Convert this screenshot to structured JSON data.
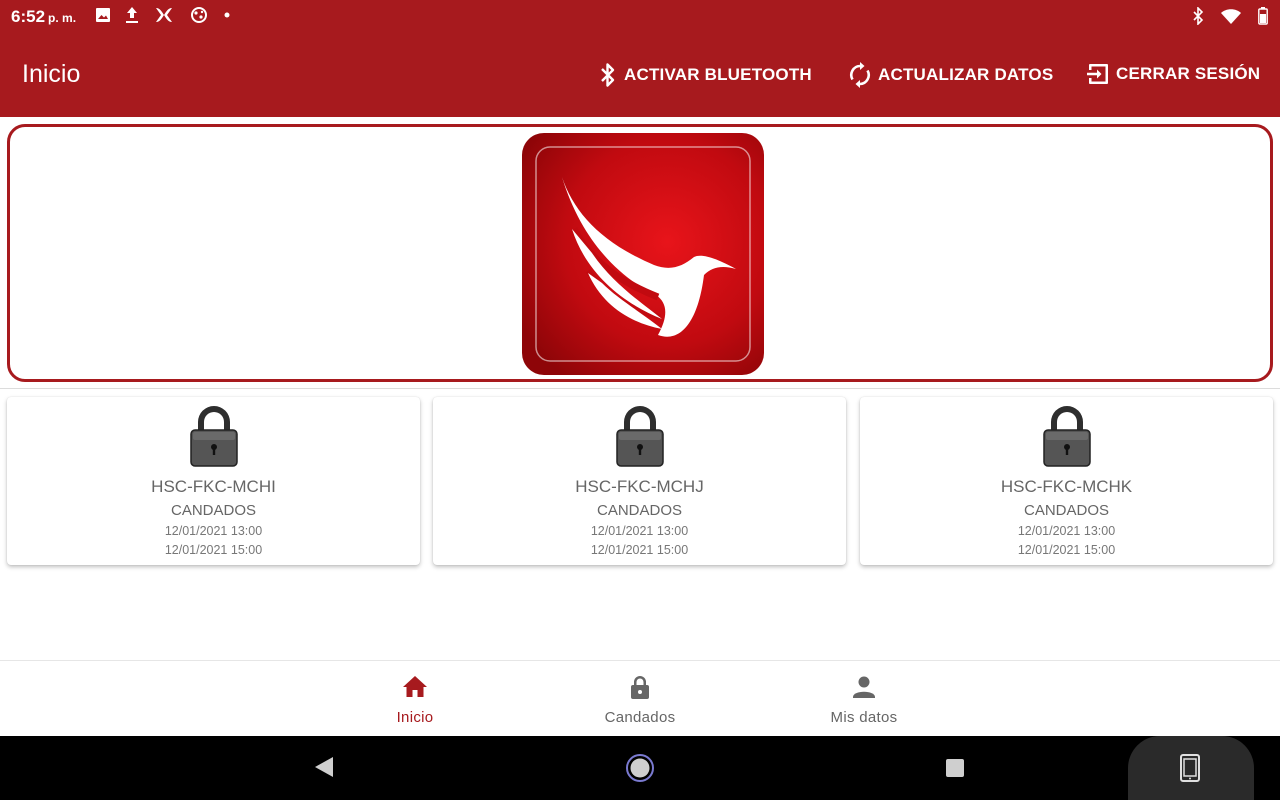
{
  "status_bar": {
    "time": "6:52",
    "time_suffix": "p. m.",
    "icons_left": [
      "image-icon",
      "upload-icon",
      "app-icon",
      "app-icon-2",
      "dot-icon"
    ],
    "icons_right": [
      "bluetooth-icon",
      "wifi-icon",
      "battery-icon"
    ]
  },
  "app_bar": {
    "title": "Inicio",
    "actions": {
      "bluetooth": "ACTIVAR BLUETOOTH",
      "sync": "ACTUALIZAR DATOS",
      "logout": "CERRAR SESIÓN"
    }
  },
  "colors": {
    "primary": "#a71a1e",
    "logo_red": "#d10a10",
    "text_secondary": "#666666",
    "lock_body": "#4a4a4a"
  },
  "cards": [
    {
      "name": "HSC-FKC-MCHI",
      "type": "CANDADOS",
      "start": "12/01/2021 13:00",
      "end": "12/01/2021 15:00",
      "icon": "padlock-icon"
    },
    {
      "name": "HSC-FKC-MCHJ",
      "type": "CANDADOS",
      "start": "12/01/2021 13:00",
      "end": "12/01/2021 15:00",
      "icon": "padlock-icon"
    },
    {
      "name": "HSC-FKC-MCHK",
      "type": "CANDADOS",
      "start": "12/01/2021 13:00",
      "end": "12/01/2021 15:00",
      "icon": "padlock-icon"
    }
  ],
  "bottom_nav": {
    "items": [
      {
        "label": "Inicio",
        "icon": "home-icon",
        "active": true
      },
      {
        "label": "Candados",
        "icon": "lock-icon",
        "active": false
      },
      {
        "label": "Mis datos",
        "icon": "person-icon",
        "active": false
      }
    ]
  },
  "system_nav": {
    "buttons": [
      "back-icon",
      "home-circle-icon",
      "recents-icon",
      "rotate-icon"
    ]
  }
}
